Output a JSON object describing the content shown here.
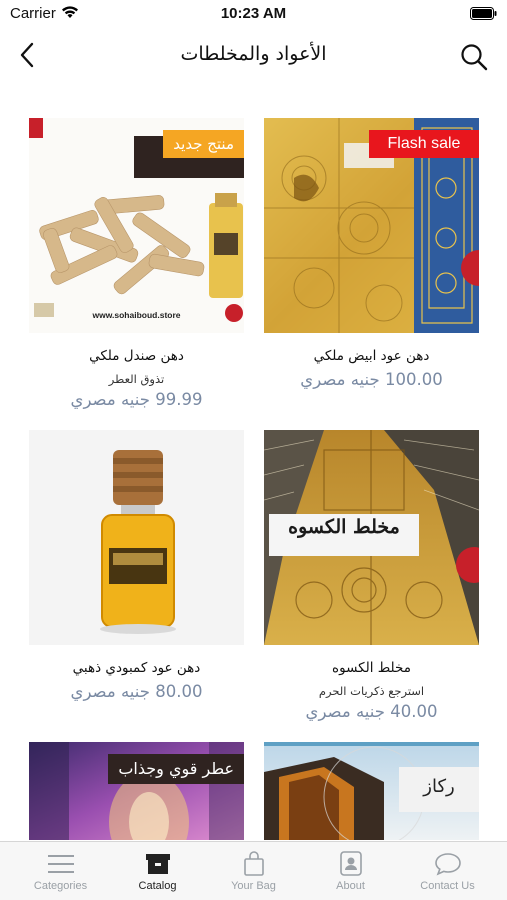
{
  "status_bar": {
    "carrier": "Carrier",
    "time": "10:23 AM"
  },
  "nav": {
    "title": "الأعواد والمخلطات"
  },
  "products": [
    {
      "name": "دهن عود ابيض ملكي",
      "subtitle": "",
      "price": "100.00 جنيه مصري",
      "badge": "Flash sale",
      "image_label": ""
    },
    {
      "name": "دهن صندل ملكي",
      "subtitle": "تذوق العطر",
      "price": "99.99 جنيه مصري",
      "badge": "منتج جديد",
      "image_label": "www.sohaiboud.store"
    },
    {
      "name": "مخلط الكسوه",
      "subtitle": "استرجع ذكريات الحرم",
      "price": "40.00 جنيه مصري",
      "badge": "",
      "image_label": "مخلط الكسوه"
    },
    {
      "name": "دهن عود كمبودي ذهبي",
      "subtitle": "",
      "price": "80.00 جنيه مصري",
      "badge": "",
      "image_label": ""
    },
    {
      "name": "",
      "subtitle": "",
      "price": "",
      "badge": "",
      "image_label": "ركاز"
    },
    {
      "name": "",
      "subtitle": "",
      "price": "",
      "badge": "",
      "image_label": "عطر قوي وجذاب"
    }
  ],
  "tabs": [
    {
      "label": "Categories",
      "icon": "menu-icon",
      "active": false
    },
    {
      "label": "Catalog",
      "icon": "box-icon",
      "active": true
    },
    {
      "label": "Your Bag",
      "icon": "bag-icon",
      "active": false
    },
    {
      "label": "About",
      "icon": "person-badge-icon",
      "active": false
    },
    {
      "label": "Contact Us",
      "icon": "chat-bubble-icon",
      "active": false
    }
  ],
  "colors": {
    "accent_price": "#7a8aa3",
    "badge_sale": "#e8161d",
    "badge_new": "#f5a623",
    "tab_active": "#222222",
    "tab_inactive": "#9aa0a6"
  }
}
